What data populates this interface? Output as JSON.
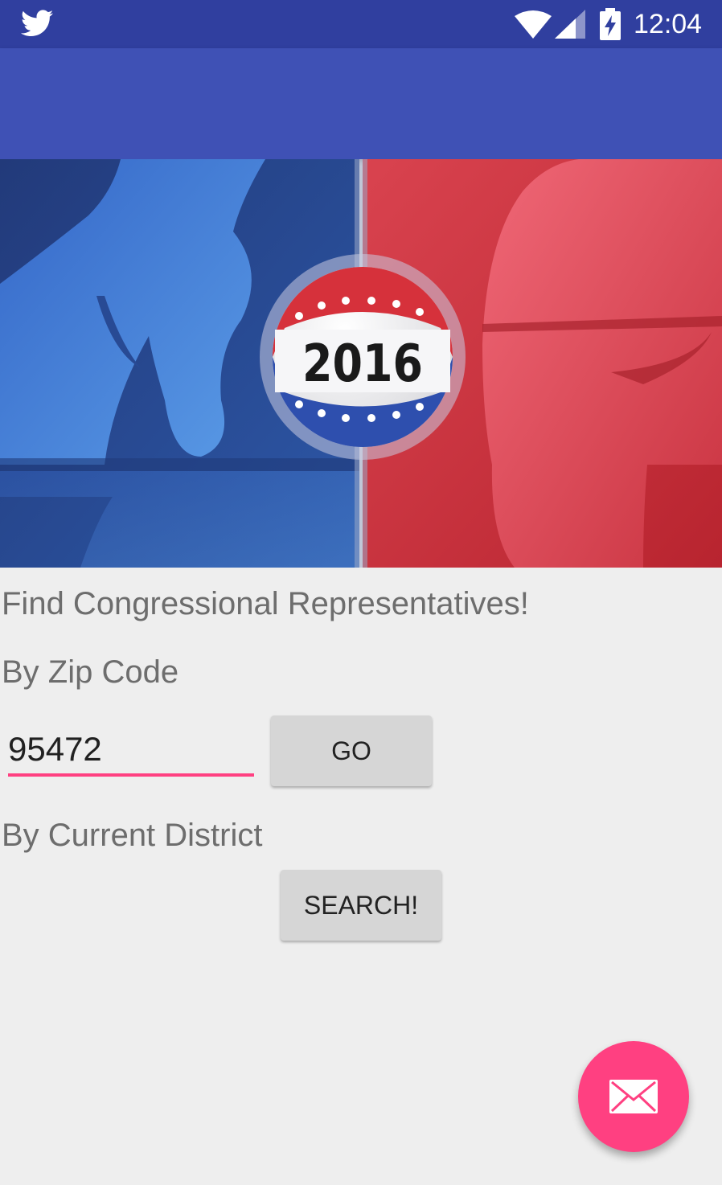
{
  "status_bar": {
    "time": "12:04",
    "icons": [
      "twitter-icon",
      "wifi-icon",
      "signal-icon",
      "battery-charging-icon"
    ]
  },
  "hero": {
    "badge_text": "2016"
  },
  "main": {
    "title": "Find Congressional Representatives!",
    "zip_label": "By Zip Code",
    "zip_value": "95472",
    "go_label": "GO",
    "district_label": "By Current District",
    "search_label": "SEARCH!"
  },
  "fab": {
    "icon": "mail-icon"
  },
  "colors": {
    "status_bar": "#303f9f",
    "app_bar": "#3f51b5",
    "accent": "#ff4081",
    "background": "#eeeeee"
  }
}
